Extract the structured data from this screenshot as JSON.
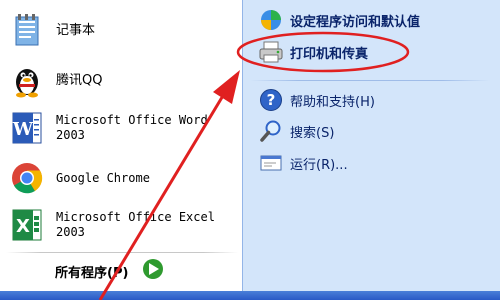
{
  "pinned_programs": [
    {
      "name": "notepad",
      "label": "记事本",
      "icon": "notepad-icon"
    },
    {
      "name": "tencent-qq",
      "label": "腾讯QQ",
      "icon": "qq-penguin-icon"
    },
    {
      "name": "word-2003",
      "label": "Microsoft Office Word\n2003",
      "icon": "word-icon"
    },
    {
      "name": "google-chrome",
      "label": "Google Chrome",
      "icon": "chrome-icon"
    },
    {
      "name": "excel-2003",
      "label": "Microsoft Office Excel\n2003",
      "icon": "excel-icon"
    }
  ],
  "all_programs": {
    "label": "所有程序(P)",
    "icon": "green-arrow-icon"
  },
  "right_items": {
    "program_access": {
      "label": "设定程序访问和默认值",
      "icon": "program-access-icon"
    },
    "printers": {
      "label": "打印机和传真",
      "icon": "printer-icon"
    },
    "help": {
      "label": "帮助和支持(H)",
      "icon": "help-icon"
    },
    "search": {
      "label": "搜索(S)",
      "icon": "search-icon"
    },
    "run": {
      "label": "运行(R)...",
      "icon": "run-icon"
    }
  },
  "annotation": {
    "highlight_color": "#e02020"
  },
  "colors": {
    "right_pane": "#d3e5fa",
    "taskbar": "#2a5ac6",
    "link_text": "#0a246a"
  }
}
